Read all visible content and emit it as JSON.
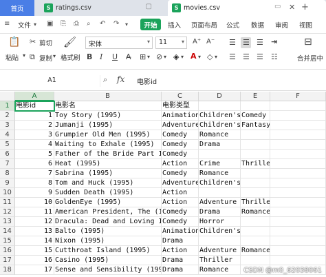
{
  "tabs": {
    "home": "首页",
    "ratings": "ratings.csv",
    "movies": "movies.csv"
  },
  "menu": {
    "file": "文件",
    "start": "开始",
    "insert": "插入",
    "page_layout": "页面布局",
    "formula": "公式",
    "data": "数据",
    "review": "审阅",
    "view": "视图"
  },
  "ribbon": {
    "cut": "剪切",
    "paste": "粘贴",
    "copy": "复制",
    "format_painter": "格式刷",
    "font_name": "宋体",
    "font_size": "11",
    "merge_center": "合并居中",
    "font_grow": "A⁺",
    "font_shrink": "A⁻"
  },
  "formula_bar": {
    "name_box": "A1",
    "fx": "fx",
    "content": "电影id"
  },
  "columns": [
    "A",
    "B",
    "C",
    "D",
    "E",
    "F"
  ],
  "rows": [
    {
      "n": "1",
      "a": "电影id",
      "b": "电影名",
      "c": "电影类型",
      "d": "",
      "e": ""
    },
    {
      "n": "2",
      "a": "1",
      "b": "Toy Story (1995)",
      "c": "Animation",
      "d": "Children's",
      "e": "Comedy"
    },
    {
      "n": "3",
      "a": "2",
      "b": "Jumanji (1995)",
      "c": "Adventure",
      "d": "Children's",
      "e": "Fantasy"
    },
    {
      "n": "4",
      "a": "3",
      "b": "Grumpier Old Men (1995)",
      "c": "Comedy",
      "d": "Romance",
      "e": ""
    },
    {
      "n": "5",
      "a": "4",
      "b": "Waiting to Exhale (1995)",
      "c": "Comedy",
      "d": "Drama",
      "e": ""
    },
    {
      "n": "6",
      "a": "5",
      "b": "Father of the Bride Part II",
      "c": "Comedy",
      "d": "",
      "e": ""
    },
    {
      "n": "7",
      "a": "6",
      "b": "Heat (1995)",
      "c": "Action",
      "d": "Crime",
      "e": "Thriller"
    },
    {
      "n": "8",
      "a": "7",
      "b": "Sabrina (1995)",
      "c": "Comedy",
      "d": "Romance",
      "e": ""
    },
    {
      "n": "9",
      "a": "8",
      "b": "Tom and Huck (1995)",
      "c": "Adventure",
      "d": "Children's",
      "e": ""
    },
    {
      "n": "10",
      "a": "9",
      "b": "Sudden Death (1995)",
      "c": "Action",
      "d": "",
      "e": ""
    },
    {
      "n": "11",
      "a": "10",
      "b": "GoldenEye (1995)",
      "c": "Action",
      "d": "Adventure",
      "e": "Thriller"
    },
    {
      "n": "12",
      "a": "11",
      "b": "American President, The (199",
      "c": "Comedy",
      "d": "Drama",
      "e": "Romance"
    },
    {
      "n": "13",
      "a": "12",
      "b": "Dracula: Dead and Loving It",
      "c": "Comedy",
      "d": "Horror",
      "e": ""
    },
    {
      "n": "14",
      "a": "13",
      "b": "Balto (1995)",
      "c": "Animation",
      "d": "Children's",
      "e": ""
    },
    {
      "n": "15",
      "a": "14",
      "b": "Nixon (1995)",
      "c": "Drama",
      "d": "",
      "e": ""
    },
    {
      "n": "16",
      "a": "15",
      "b": "Cutthroat Island (1995)",
      "c": "Action",
      "d": "Adventure",
      "e": "Romance"
    },
    {
      "n": "17",
      "a": "16",
      "b": "Casino (1995)",
      "c": "Drama",
      "d": "Thriller",
      "e": ""
    },
    {
      "n": "18",
      "a": "17",
      "b": "Sense and Sensibility (1995)",
      "c": "Drama",
      "d": "Romance",
      "e": ""
    }
  ],
  "watermark": "CSDN @m0_62038061",
  "colors": {
    "accent": "#1ba35b",
    "home_tab": "#4a7ee6",
    "selection": "#d7e6d6"
  }
}
